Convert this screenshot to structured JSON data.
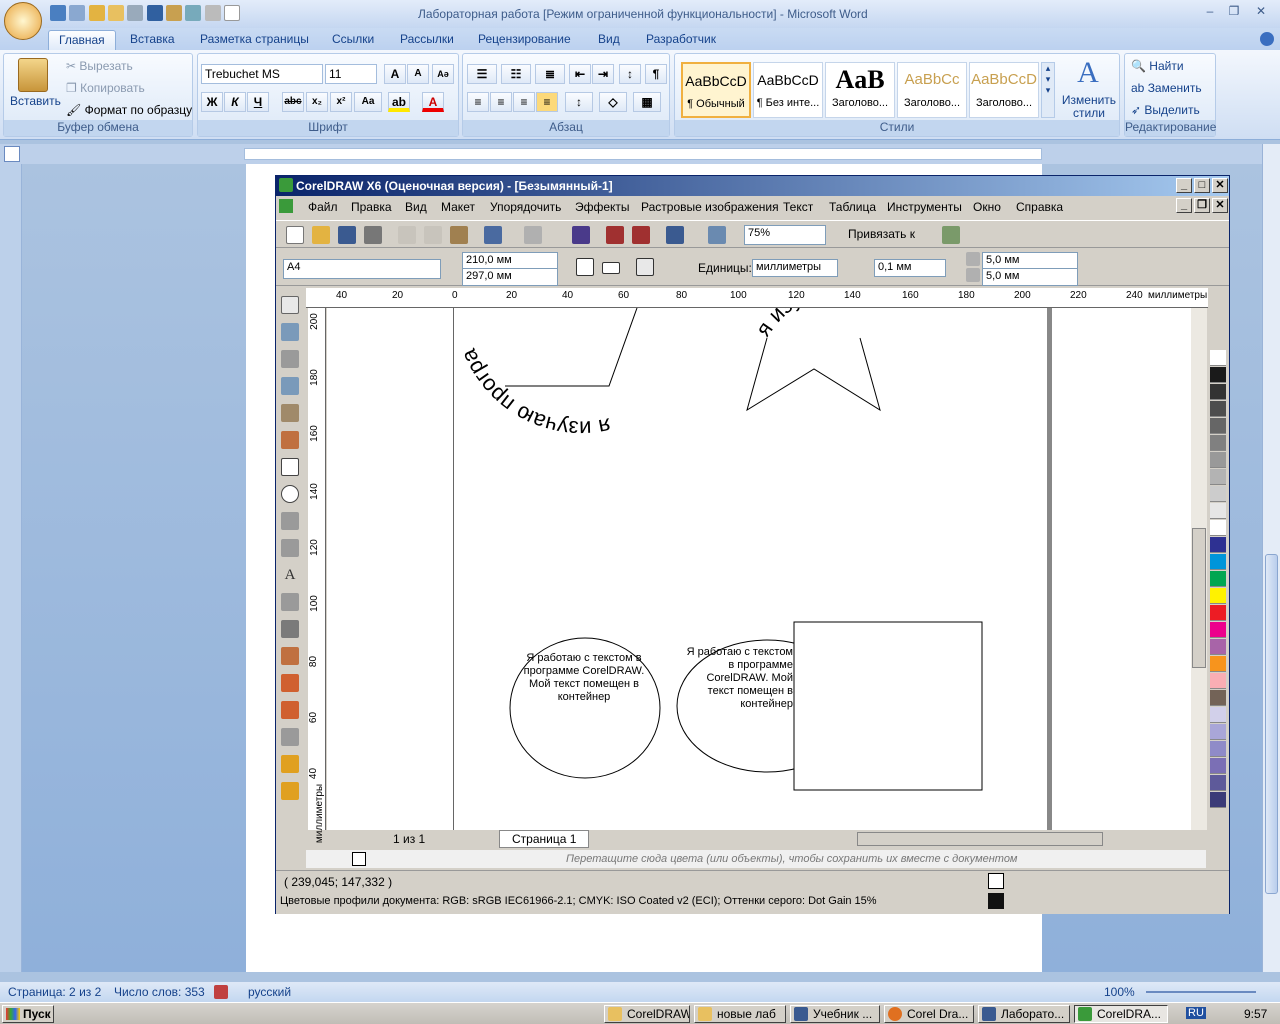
{
  "word": {
    "title": "Лабораторная работа [Режим ограниченной функциональности] - Microsoft Word",
    "tabs": [
      "Главная",
      "Вставка",
      "Разметка страницы",
      "Ссылки",
      "Рассылки",
      "Рецензирование",
      "Вид",
      "Разработчик"
    ],
    "clipboard": {
      "paste": "Вставить",
      "cut": "Вырезать",
      "copy": "Копировать",
      "format": "Формат по образцу",
      "label": "Буфер обмена"
    },
    "font": {
      "name": "Trebuchet MS",
      "size": "11",
      "label": "Шрифт",
      "bold": "Ж",
      "italic": "К",
      "underline": "Ч"
    },
    "paragraph": {
      "label": "Абзац"
    },
    "styles": {
      "items": [
        {
          "preview": "AaBbCcD",
          "name": "¶ Обычный"
        },
        {
          "preview": "AaBbCcD",
          "name": "¶ Без инте..."
        },
        {
          "preview": "AaB",
          "name": "Заголово..."
        },
        {
          "preview": "AaBbCc",
          "name": "Заголово..."
        },
        {
          "preview": "AaBbCcD",
          "name": "Заголово..."
        }
      ],
      "change": "Изменить стили",
      "label": "Стили"
    },
    "editing": {
      "find": "Найти",
      "replace": "Заменить",
      "select": "Выделить",
      "label": "Редактирование"
    },
    "status": {
      "page": "Страница: 2 из 2",
      "words": "Число слов: 353",
      "lang": "русский",
      "zoom": "100%"
    }
  },
  "corel": {
    "title": "CorelDRAW X6 (Оценочная версия) - [Безымянный-1]",
    "menu": [
      "Файл",
      "Правка",
      "Вид",
      "Макет",
      "Упорядочить",
      "Эффекты",
      "Растровые изображения",
      "Текст",
      "Таблица",
      "Инструменты",
      "Окно",
      "Справка"
    ],
    "zoom": "75%",
    "snap": "Привязать к",
    "page_size": "A4",
    "width": "210,0 мм",
    "height": "297,0 мм",
    "units_label": "Единицы:",
    "units": "миллиметры",
    "nudge": "0,1 мм",
    "dup_x": "5,0 мм",
    "dup_y": "5,0 мм",
    "h_ruler": [
      "40",
      "20",
      "0",
      "20",
      "40",
      "60",
      "80",
      "100",
      "120",
      "140",
      "160",
      "180",
      "200",
      "220",
      "240"
    ],
    "h_ruler_unit": "миллиметры",
    "v_ruler": [
      "200",
      "180",
      "160",
      "140",
      "120",
      "100",
      "80",
      "60",
      "40"
    ],
    "v_ruler_unit": "миллиметры",
    "arc_text_1": "я изучаю програ",
    "arc_text_2": "я изучаю CorelDRAW",
    "circle_text": "Я работаю с текстом в программе CorelDRAW. Мой текст помещен в контейнер",
    "page_nav": "1 из 1",
    "page_tab": "Страница 1",
    "palette_hint": "Перетащите сюда цвета (или объекты), чтобы сохранить их вместе с документом",
    "coords": "( 239,045; 147,332 )",
    "color_profile": "Цветовые профили документа: RGB: sRGB IEC61966-2.1; CMYK: ISO Coated v2 (ECI); Оттенки серого: Dot Gain 15%",
    "palette": [
      "#ffffff",
      "#1a1a1a",
      "#333333",
      "#4d4d4d",
      "#666666",
      "#808080",
      "#999999",
      "#b3b3b3",
      "#cccccc",
      "#e6e6e6",
      "#ffffff",
      "#2e3192",
      "#0095da",
      "#00a651",
      "#fff200",
      "#ed1c24",
      "#ec008c",
      "#a864a8",
      "#f7941d",
      "#f9aeb4",
      "#736357",
      "#d2d0ea",
      "#a9a6d8",
      "#8f8bc8",
      "#7b6fb5",
      "#5e5a9a",
      "#3b3b78"
    ]
  },
  "taskbar": {
    "start": "Пуск",
    "tasks": [
      "CorelDRAW",
      "новые лаб",
      "Учебник ...",
      "Corel Dra...",
      "Лаборато...",
      "CorelDRA..."
    ],
    "lang": "RU",
    "time": "9:57"
  }
}
